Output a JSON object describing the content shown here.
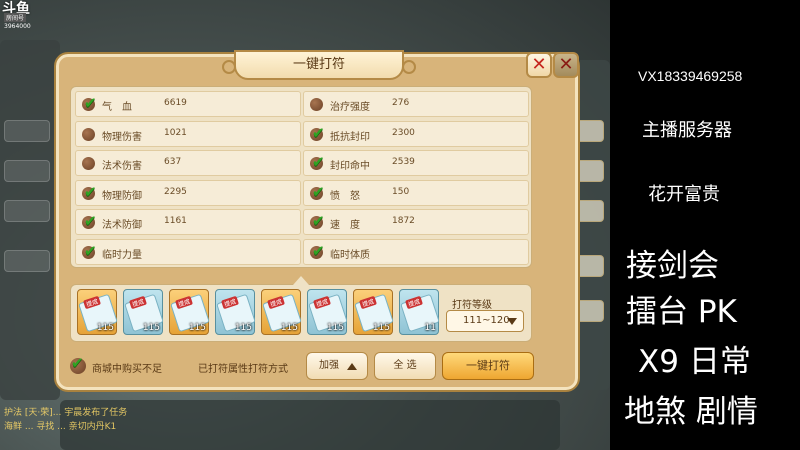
{
  "stream_logo": {
    "brand": "斗鱼",
    "sub": "房间号",
    "room": "3964000"
  },
  "dialog": {
    "title": "一键打符",
    "close_glyph": "✕",
    "attributes_left": [
      {
        "name": "气　血",
        "value": "6619",
        "checked": true
      },
      {
        "name": "物理伤害",
        "value": "1021",
        "checked": false
      },
      {
        "name": "法术伤害",
        "value": "637",
        "checked": false
      },
      {
        "name": "物理防御",
        "value": "2295",
        "checked": true
      },
      {
        "name": "法术防御",
        "value": "1161",
        "checked": true
      },
      {
        "name": "临时力量",
        "value": "",
        "checked": true
      }
    ],
    "attributes_right": [
      {
        "name": "治疗强度",
        "value": "276",
        "checked": false
      },
      {
        "name": "抵抗封印",
        "value": "2300",
        "checked": true
      },
      {
        "name": "封印命中",
        "value": "2539",
        "checked": true
      },
      {
        "name": "愤　怒",
        "value": "150",
        "checked": true
      },
      {
        "name": "速　度",
        "value": "1872",
        "checked": true
      },
      {
        "name": "临时体质",
        "value": "",
        "checked": true
      }
    ],
    "talismans": [
      {
        "tag": "提成",
        "level": "115",
        "color": "gold"
      },
      {
        "tag": "提成",
        "level": "115",
        "color": "blue"
      },
      {
        "tag": "提成",
        "level": "115",
        "color": "gold"
      },
      {
        "tag": "提成",
        "level": "115",
        "color": "blue"
      },
      {
        "tag": "提成",
        "level": "115",
        "color": "gold"
      },
      {
        "tag": "提成",
        "level": "115",
        "color": "blue"
      },
      {
        "tag": "提成",
        "level": "115",
        "color": "gold"
      },
      {
        "tag": "提成",
        "level": "11",
        "color": "blue"
      }
    ],
    "level_label": "打符等级",
    "level_value": "111~120",
    "buy_label": "商城中购买不足",
    "method_label": "已打符属性打符方式",
    "enhance_label": "加强",
    "select_all_label": "全 选",
    "primary_label": "一键打符"
  },
  "chat": [
    "护法 [天·荣]... 宇晨发布了任务",
    "海鲜 ... 寻找 ... 亲切内丹K1"
  ],
  "overlay": {
    "contact": "VX18339469258",
    "server": "主播服务器",
    "name": "花开富贵",
    "line1": "接剑会",
    "line2": "擂台 PK",
    "line3": "X9 日常",
    "line4": "地煞 剧情"
  }
}
